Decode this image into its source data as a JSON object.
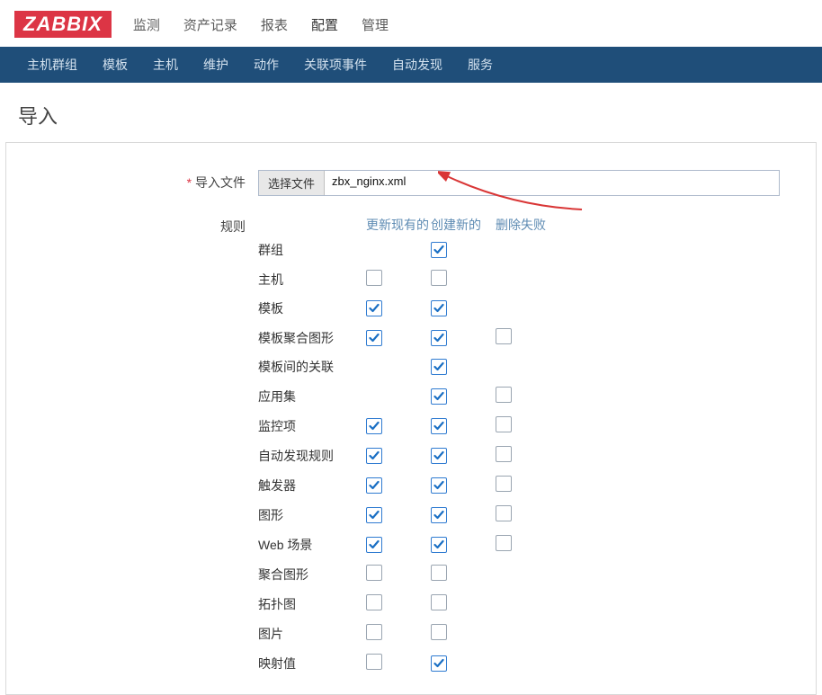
{
  "logo": "ZABBIX",
  "top_menu": {
    "items": [
      "监测",
      "资产记录",
      "报表",
      "配置",
      "管理"
    ],
    "active_index": 3
  },
  "sub_menu": {
    "items": [
      "主机群组",
      "模板",
      "主机",
      "维护",
      "动作",
      "关联项事件",
      "自动发现",
      "服务"
    ]
  },
  "page_title": "导入",
  "form": {
    "import_file_label": "导入文件",
    "file_button": "选择文件",
    "file_name": "zbx_nginx.xml",
    "rules_label": "规则",
    "columns": [
      "更新现有的",
      "创建新的",
      "删除失败"
    ],
    "rules": [
      {
        "name": "群组",
        "update": null,
        "create": true,
        "delete": null
      },
      {
        "name": "主机",
        "update": false,
        "create": false,
        "delete": null
      },
      {
        "name": "模板",
        "update": true,
        "create": true,
        "delete": null
      },
      {
        "name": "模板聚合图形",
        "update": true,
        "create": true,
        "delete": false
      },
      {
        "name": "模板间的关联",
        "update": null,
        "create": true,
        "delete": null
      },
      {
        "name": "应用集",
        "update": null,
        "create": true,
        "delete": false
      },
      {
        "name": "监控项",
        "update": true,
        "create": true,
        "delete": false
      },
      {
        "name": "自动发现规则",
        "update": true,
        "create": true,
        "delete": false
      },
      {
        "name": "触发器",
        "update": true,
        "create": true,
        "delete": false
      },
      {
        "name": "图形",
        "update": true,
        "create": true,
        "delete": false
      },
      {
        "name": "Web 场景",
        "update": true,
        "create": true,
        "delete": false
      },
      {
        "name": "聚合图形",
        "update": false,
        "create": false,
        "delete": null
      },
      {
        "name": "拓扑图",
        "update": false,
        "create": false,
        "delete": null
      },
      {
        "name": "图片",
        "update": false,
        "create": false,
        "delete": null
      },
      {
        "name": "映射值",
        "update": false,
        "create": true,
        "delete": null
      }
    ]
  }
}
